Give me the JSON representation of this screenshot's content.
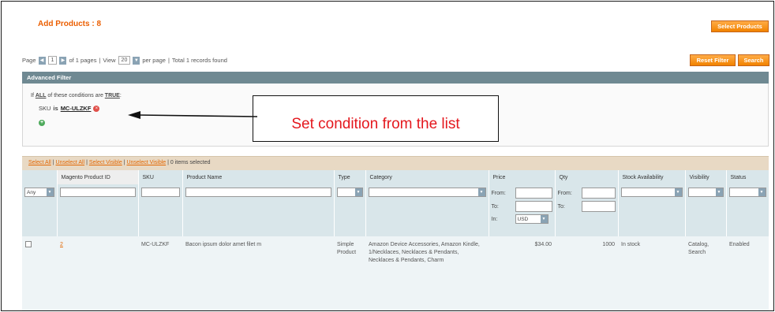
{
  "title": "Add Products : 8",
  "buttons": {
    "select_products": "Select Products",
    "reset_filter": "Reset Filter",
    "search": "Search"
  },
  "pager": {
    "page_label": "Page",
    "page_value": "1",
    "of_pages": "of 1 pages",
    "view_label": "View",
    "view_value": "20",
    "per_page": "per page",
    "total": "Total 1 records found"
  },
  "advanced_filter": {
    "header": "Advanced Filter",
    "cond_prefix": "If",
    "cond_all": "ALL",
    "cond_middle": "of these conditions are",
    "cond_true": "TRUE",
    "cond_suffix": ":",
    "attribute": "SKU",
    "operator": "is",
    "value": "MC-ULZKF",
    "remove_symbol": "×",
    "add_symbol": "+"
  },
  "callout": {
    "text": "Set condition from the list"
  },
  "massaction": {
    "select_all": "Select All",
    "unselect_all": "Unselect All",
    "select_visible": "Select Visible",
    "unselect_visible": "Unselect Visible",
    "separator": "|",
    "items_selected": "0 items selected"
  },
  "grid": {
    "columns": [
      "",
      "Magento Product ID",
      "SKU",
      "Product Name",
      "Type",
      "Category",
      "Price",
      "Qty",
      "Stock Availability",
      "Visibility",
      "Status"
    ],
    "filters": {
      "checkbox_filter": "Any",
      "price_from": "From:",
      "price_to": "To:",
      "price_in": "In:",
      "currency": "USD",
      "qty_from": "From:",
      "qty_to": "To:"
    },
    "row": {
      "id": "2",
      "sku": "MC-ULZKF",
      "name": "Bacon ipsum dolor amet filet m",
      "type": "Simple Product",
      "category": "Amazon Device Accessories, Amazon Kindle, 1/Necklaces, Necklaces & Pendants, Necklaces & Pendants, Charm",
      "price": "$34.00",
      "qty": "1000",
      "stock": "In stock",
      "visibility": "Catalog, Search",
      "status": "Enabled"
    }
  }
}
